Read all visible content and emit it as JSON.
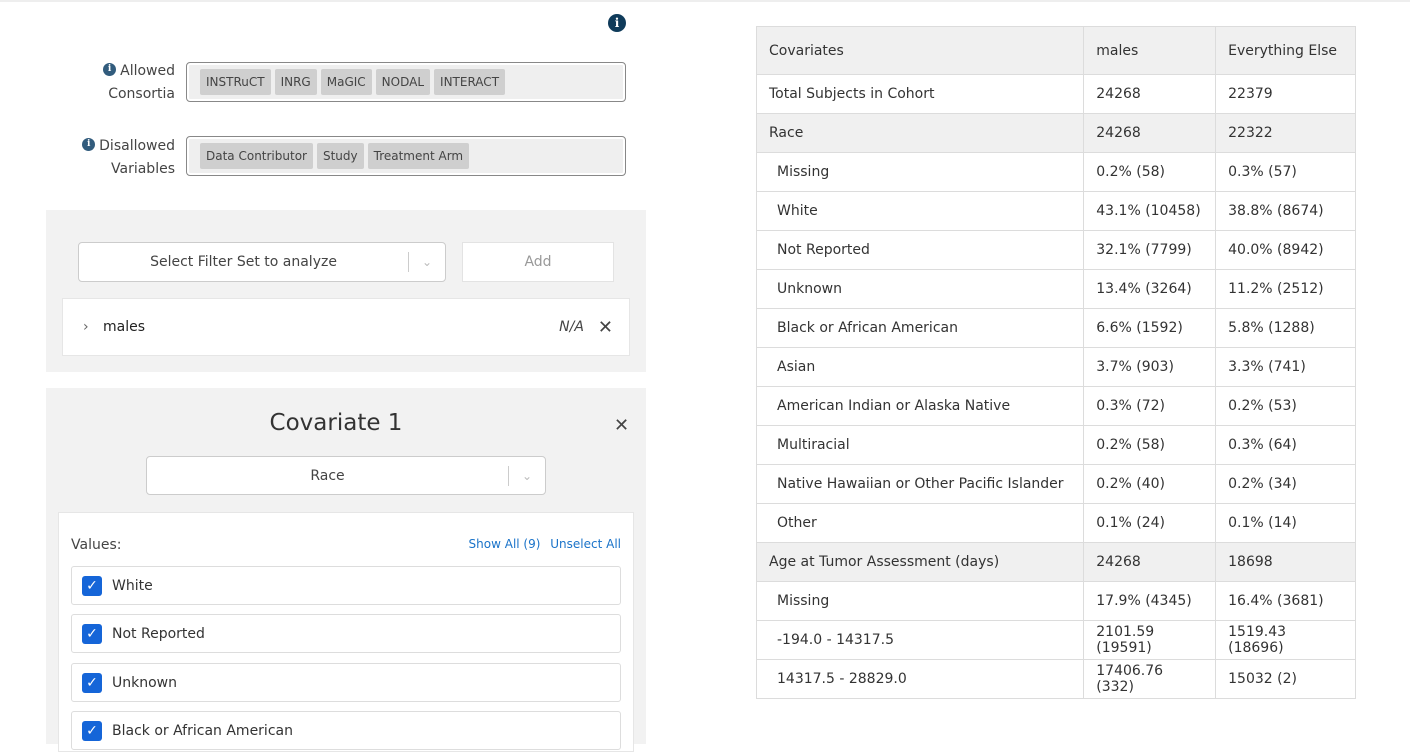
{
  "left": {
    "allowed_consortia": {
      "label_line1": "Allowed",
      "label_line2": "Consortia",
      "tags": [
        "INSTRuCT",
        "INRG",
        "MaGIC",
        "NODAL",
        "INTERACT"
      ]
    },
    "disallowed_variables": {
      "label_line1": "Disallowed",
      "label_line2": "Variables",
      "tags": [
        "Data Contributor",
        "Study",
        "Treatment Arm"
      ]
    },
    "filter_set": {
      "select_placeholder": "Select Filter Set to analyze",
      "add_label": "Add",
      "item_name": "males",
      "item_status": "N/A"
    },
    "covariate": {
      "title": "Covariate 1",
      "selected": "Race",
      "values_label": "Values:",
      "show_all": "Show All (9)",
      "unselect_all": "Unselect All",
      "values": [
        "White",
        "Not Reported",
        "Unknown",
        "Black or African American"
      ]
    }
  },
  "table": {
    "headers": [
      "Covariates",
      "males",
      "Everything Else"
    ],
    "rows": [
      {
        "type": "plain",
        "cells": [
          "Total Subjects in Cohort",
          "24268",
          "22379"
        ]
      },
      {
        "type": "group",
        "cells": [
          "Race",
          "24268",
          "22322"
        ]
      },
      {
        "type": "sub",
        "cells": [
          "Missing",
          "0.2% (58)",
          "0.3% (57)"
        ]
      },
      {
        "type": "sub",
        "cells": [
          "White",
          "43.1% (10458)",
          "38.8% (8674)"
        ]
      },
      {
        "type": "sub",
        "cells": [
          "Not Reported",
          "32.1% (7799)",
          "40.0% (8942)"
        ]
      },
      {
        "type": "sub",
        "cells": [
          "Unknown",
          "13.4% (3264)",
          "11.2% (2512)"
        ]
      },
      {
        "type": "sub",
        "cells": [
          "Black or African American",
          "6.6% (1592)",
          "5.8% (1288)"
        ]
      },
      {
        "type": "sub",
        "cells": [
          "Asian",
          "3.7% (903)",
          "3.3% (741)"
        ]
      },
      {
        "type": "sub",
        "cells": [
          "American Indian or Alaska Native",
          "0.3% (72)",
          "0.2% (53)"
        ]
      },
      {
        "type": "sub",
        "cells": [
          "Multiracial",
          "0.2% (58)",
          "0.3% (64)"
        ]
      },
      {
        "type": "sub",
        "cells": [
          "Native Hawaiian or Other Pacific Islander",
          "0.2% (40)",
          "0.2% (34)"
        ]
      },
      {
        "type": "sub",
        "cells": [
          "Other",
          "0.1% (24)",
          "0.1% (14)"
        ]
      },
      {
        "type": "group",
        "cells": [
          "Age at Tumor Assessment (days)",
          "24268",
          "18698"
        ]
      },
      {
        "type": "sub",
        "cells": [
          "Missing",
          "17.9% (4345)",
          "16.4% (3681)"
        ]
      },
      {
        "type": "sub",
        "cells": [
          "-194.0 - 14317.5",
          "2101.59 (19591)",
          "1519.43 (18696)"
        ]
      },
      {
        "type": "sub",
        "cells": [
          "14317.5 - 28829.0",
          "17406.76 (332)",
          "15032 (2)"
        ]
      }
    ]
  }
}
